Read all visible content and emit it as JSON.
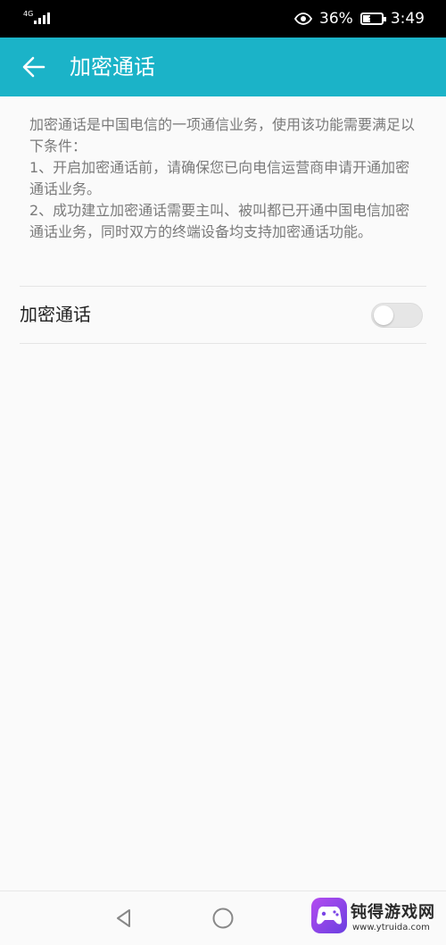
{
  "status_bar": {
    "network": "4G",
    "battery_percent": "36%",
    "time": "3:49",
    "signal_level": 0.8,
    "battery_level": 0.36
  },
  "app_bar": {
    "title": "加密通话",
    "background_color": "#1bb3c8"
  },
  "description": "加密通话是中国电信的一项通信业务，使用该功能需要满足以下条件：\n1、开启加密通话前，请确保您已向电信运营商申请开通加密通话业务。\n2、成功建立加密通话需要主叫、被叫都已开通中国电信加密通话业务，同时双方的终端设备均支持加密通话功能。",
  "setting": {
    "label": "加密通话",
    "enabled": false
  },
  "nav_bar": {
    "icons": [
      "back-triangle-icon",
      "home-circle-icon",
      "recents-square-icon"
    ]
  },
  "watermark": {
    "title": "钝得游戏网",
    "url": "www.ytruida.com"
  }
}
